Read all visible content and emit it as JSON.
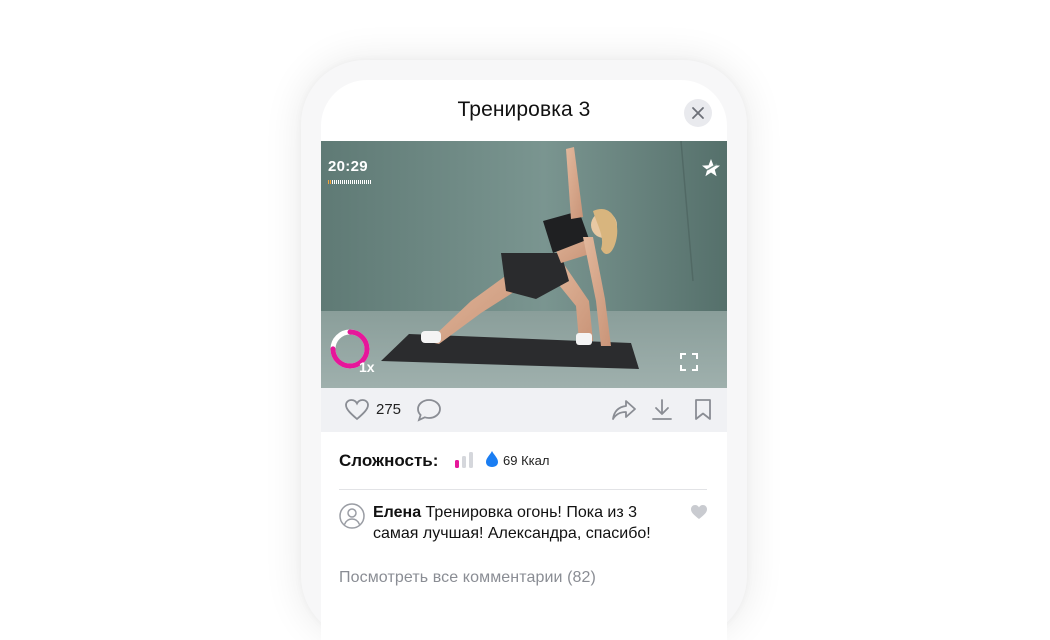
{
  "header": {
    "title": "Тренировка 3"
  },
  "video": {
    "timer": "20:29",
    "progress_fraction": 0.08,
    "speed_label": "1x",
    "speed_ring_fraction": 0.75,
    "accent_color": "#e6179a"
  },
  "actions": {
    "likes": "275"
  },
  "info": {
    "difficulty_label": "Сложность:",
    "difficulty_level": 1,
    "difficulty_max": 3,
    "kcal": "69 Ккал"
  },
  "comment": {
    "author": "Елена",
    "text": " Тренировка огонь! Пока из 3 самая лучшая! Александра, спасибо!"
  },
  "all_comments_link": "Посмотреть все комментарии (82)",
  "colors": {
    "accent": "#e6179a",
    "drop": "#1a7df2",
    "timer_progress": "#f2a53a"
  },
  "icons": [
    "close-icon",
    "star-icon",
    "fullscreen-icon",
    "heart-icon",
    "comment-icon",
    "share-icon",
    "download-icon",
    "bookmark-icon",
    "drop-icon",
    "avatar-icon"
  ]
}
